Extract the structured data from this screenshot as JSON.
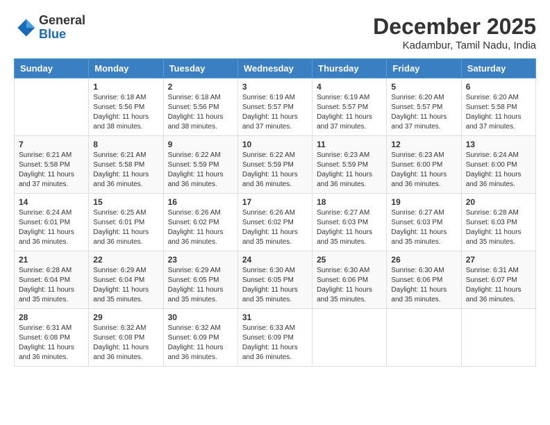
{
  "header": {
    "logo_general": "General",
    "logo_blue": "Blue",
    "month_title": "December 2025",
    "location": "Kadambur, Tamil Nadu, India"
  },
  "days_of_week": [
    "Sunday",
    "Monday",
    "Tuesday",
    "Wednesday",
    "Thursday",
    "Friday",
    "Saturday"
  ],
  "weeks": [
    [
      {
        "day": "",
        "info": ""
      },
      {
        "day": "1",
        "info": "Sunrise: 6:18 AM\nSunset: 5:56 PM\nDaylight: 11 hours\nand 38 minutes."
      },
      {
        "day": "2",
        "info": "Sunrise: 6:18 AM\nSunset: 5:56 PM\nDaylight: 11 hours\nand 38 minutes."
      },
      {
        "day": "3",
        "info": "Sunrise: 6:19 AM\nSunset: 5:57 PM\nDaylight: 11 hours\nand 37 minutes."
      },
      {
        "day": "4",
        "info": "Sunrise: 6:19 AM\nSunset: 5:57 PM\nDaylight: 11 hours\nand 37 minutes."
      },
      {
        "day": "5",
        "info": "Sunrise: 6:20 AM\nSunset: 5:57 PM\nDaylight: 11 hours\nand 37 minutes."
      },
      {
        "day": "6",
        "info": "Sunrise: 6:20 AM\nSunset: 5:58 PM\nDaylight: 11 hours\nand 37 minutes."
      }
    ],
    [
      {
        "day": "7",
        "info": "Sunrise: 6:21 AM\nSunset: 5:58 PM\nDaylight: 11 hours\nand 37 minutes."
      },
      {
        "day": "8",
        "info": "Sunrise: 6:21 AM\nSunset: 5:58 PM\nDaylight: 11 hours\nand 36 minutes."
      },
      {
        "day": "9",
        "info": "Sunrise: 6:22 AM\nSunset: 5:59 PM\nDaylight: 11 hours\nand 36 minutes."
      },
      {
        "day": "10",
        "info": "Sunrise: 6:22 AM\nSunset: 5:59 PM\nDaylight: 11 hours\nand 36 minutes."
      },
      {
        "day": "11",
        "info": "Sunrise: 6:23 AM\nSunset: 5:59 PM\nDaylight: 11 hours\nand 36 minutes."
      },
      {
        "day": "12",
        "info": "Sunrise: 6:23 AM\nSunset: 6:00 PM\nDaylight: 11 hours\nand 36 minutes."
      },
      {
        "day": "13",
        "info": "Sunrise: 6:24 AM\nSunset: 6:00 PM\nDaylight: 11 hours\nand 36 minutes."
      }
    ],
    [
      {
        "day": "14",
        "info": "Sunrise: 6:24 AM\nSunset: 6:01 PM\nDaylight: 11 hours\nand 36 minutes."
      },
      {
        "day": "15",
        "info": "Sunrise: 6:25 AM\nSunset: 6:01 PM\nDaylight: 11 hours\nand 36 minutes."
      },
      {
        "day": "16",
        "info": "Sunrise: 6:26 AM\nSunset: 6:02 PM\nDaylight: 11 hours\nand 36 minutes."
      },
      {
        "day": "17",
        "info": "Sunrise: 6:26 AM\nSunset: 6:02 PM\nDaylight: 11 hours\nand 35 minutes."
      },
      {
        "day": "18",
        "info": "Sunrise: 6:27 AM\nSunset: 6:03 PM\nDaylight: 11 hours\nand 35 minutes."
      },
      {
        "day": "19",
        "info": "Sunrise: 6:27 AM\nSunset: 6:03 PM\nDaylight: 11 hours\nand 35 minutes."
      },
      {
        "day": "20",
        "info": "Sunrise: 6:28 AM\nSunset: 6:03 PM\nDaylight: 11 hours\nand 35 minutes."
      }
    ],
    [
      {
        "day": "21",
        "info": "Sunrise: 6:28 AM\nSunset: 6:04 PM\nDaylight: 11 hours\nand 35 minutes."
      },
      {
        "day": "22",
        "info": "Sunrise: 6:29 AM\nSunset: 6:04 PM\nDaylight: 11 hours\nand 35 minutes."
      },
      {
        "day": "23",
        "info": "Sunrise: 6:29 AM\nSunset: 6:05 PM\nDaylight: 11 hours\nand 35 minutes."
      },
      {
        "day": "24",
        "info": "Sunrise: 6:30 AM\nSunset: 6:05 PM\nDaylight: 11 hours\nand 35 minutes."
      },
      {
        "day": "25",
        "info": "Sunrise: 6:30 AM\nSunset: 6:06 PM\nDaylight: 11 hours\nand 35 minutes."
      },
      {
        "day": "26",
        "info": "Sunrise: 6:30 AM\nSunset: 6:06 PM\nDaylight: 11 hours\nand 35 minutes."
      },
      {
        "day": "27",
        "info": "Sunrise: 6:31 AM\nSunset: 6:07 PM\nDaylight: 11 hours\nand 36 minutes."
      }
    ],
    [
      {
        "day": "28",
        "info": "Sunrise: 6:31 AM\nSunset: 6:08 PM\nDaylight: 11 hours\nand 36 minutes."
      },
      {
        "day": "29",
        "info": "Sunrise: 6:32 AM\nSunset: 6:08 PM\nDaylight: 11 hours\nand 36 minutes."
      },
      {
        "day": "30",
        "info": "Sunrise: 6:32 AM\nSunset: 6:09 PM\nDaylight: 11 hours\nand 36 minutes."
      },
      {
        "day": "31",
        "info": "Sunrise: 6:33 AM\nSunset: 6:09 PM\nDaylight: 11 hours\nand 36 minutes."
      },
      {
        "day": "",
        "info": ""
      },
      {
        "day": "",
        "info": ""
      },
      {
        "day": "",
        "info": ""
      }
    ]
  ]
}
